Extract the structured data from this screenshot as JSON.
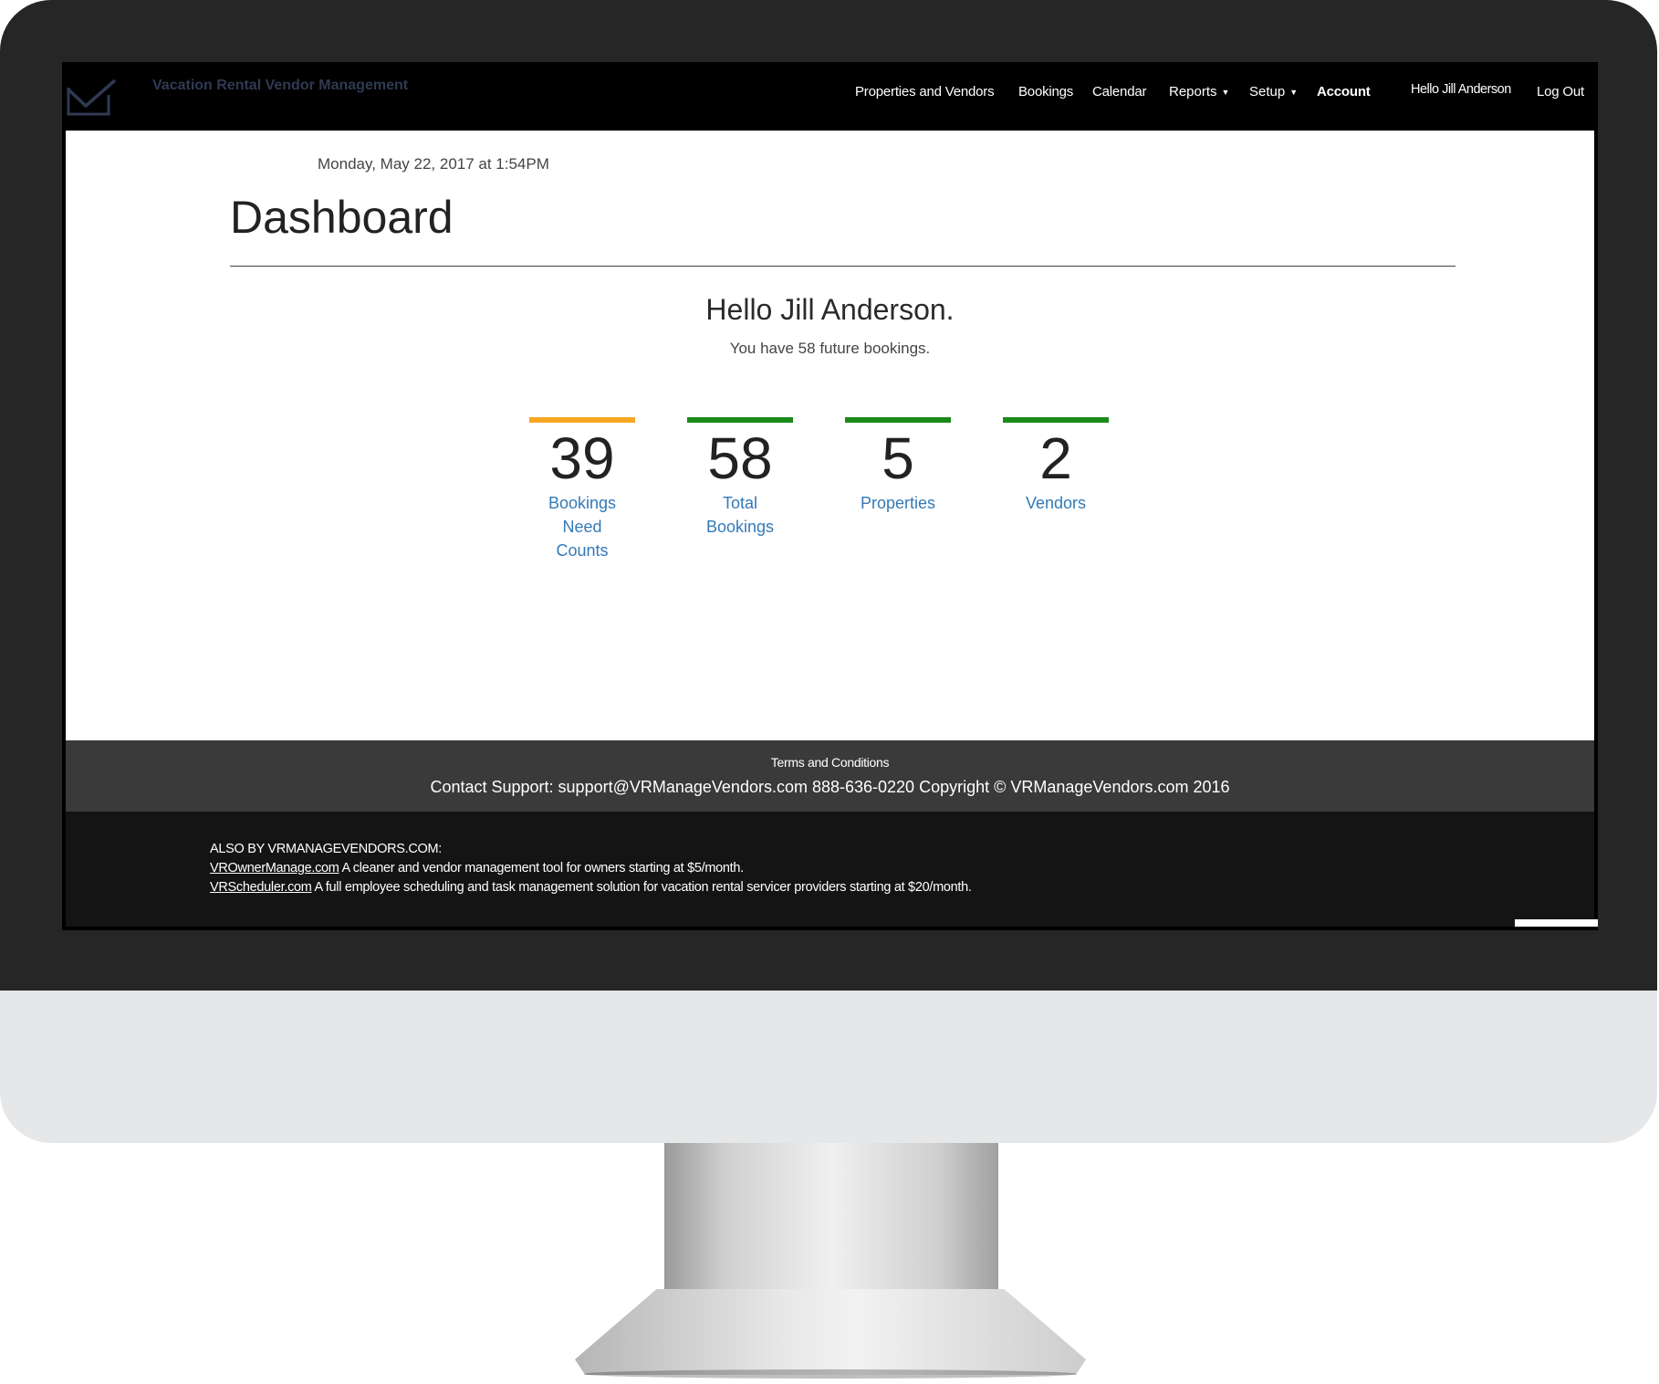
{
  "brand": {
    "name": "Vacation Rental Vendor Management",
    "logo_icon": "check-envelope-icon"
  },
  "nav": {
    "items": [
      {
        "label": "Properties and Vendors"
      },
      {
        "label": "Bookings"
      },
      {
        "label": "Calendar"
      },
      {
        "label": "Reports"
      },
      {
        "label": "Setup"
      },
      {
        "label": "Account"
      }
    ],
    "user_greeting": "Hello Jill Anderson",
    "logout_label": "Log Out"
  },
  "main": {
    "datetime": "Monday, May 22, 2017 at 1:54PM",
    "title": "Dashboard",
    "greeting": "Hello Jill Anderson.",
    "subtext": "You have 58 future bookings.",
    "stats": [
      {
        "value": "39",
        "label": "Bookings Need Counts",
        "accent": "#f5a623"
      },
      {
        "value": "58",
        "label": "Total Bookings",
        "accent": "#1a8a1a"
      },
      {
        "value": "5",
        "label": "Properties",
        "accent": "#1a8a1a"
      },
      {
        "value": "2",
        "label": "Vendors",
        "accent": "#1a8a1a"
      }
    ]
  },
  "footer": {
    "terms_label": "Terms and Conditions",
    "contact_text": "Contact Support: support@VRManageVendors.com 888-636-0220 Copyright © VRManageVendors.com 2016",
    "also_heading": "ALSO BY VRMANAGEVENDORS.COM:",
    "products": [
      {
        "link": "VROwnerManage.com",
        "desc": " A cleaner and vendor management tool for owners starting at $5/month."
      },
      {
        "link": "VRScheduler.com",
        "desc": " A full employee scheduling and task management solution for vacation rental servicer providers starting at $20/month."
      }
    ]
  },
  "colors": {
    "link": "#337ab7",
    "warning_accent": "#f5a623",
    "success_accent": "#1a8a1a"
  }
}
